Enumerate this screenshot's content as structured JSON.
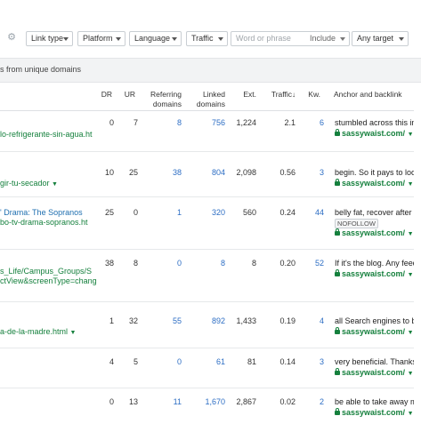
{
  "toolbar": {
    "gear_icon": "gear-icon",
    "link_type": "Link type",
    "platform": "Platform",
    "language": "Language",
    "traffic": "Traffic",
    "phrase_placeholder": "Word or phrase",
    "include": "Include",
    "any_target": "Any target"
  },
  "subheader": "s from unique domains",
  "columns": {
    "dr": "DR",
    "ur": "UR",
    "referring_1": "Referring",
    "referring_2": "domains",
    "linked_1": "Linked",
    "linked_2": "domains",
    "ext": "Ext.",
    "traffic": "Traffic",
    "traffic_sort": "↓",
    "kw": "Kw.",
    "anchor": "Anchor and backlink"
  },
  "rows": [
    {
      "ref_lines": [
        "lo-refrigerante-sin-agua.ht"
      ],
      "dr": "0",
      "ur": "7",
      "rd": "8",
      "ld": "756",
      "ext": "1,224",
      "traffic": "2.1",
      "kw": "6",
      "anchor": "stumbled across this in m",
      "backlink": "sassywaist.com/"
    },
    {
      "ref_lines": [
        "gir-tu-secador"
      ],
      "dr": "10",
      "ur": "25",
      "rd": "38",
      "ld": "804",
      "ext": "2,098",
      "traffic": "0.56",
      "kw": "3",
      "anchor": "begin. So it pays to look f",
      "backlink": "sassywaist.com/"
    },
    {
      "ref_lines": [
        "' Drama: The Sopranos",
        "bo-tv-drama-sopranos.ht"
      ],
      "dr": "25",
      "ur": "0",
      "rd": "1",
      "ld": "320",
      "ext": "560",
      "traffic": "0.24",
      "kw": "44",
      "anchor": "belly fat, recover after giv",
      "badge": "NOFOLLOW",
      "backlink": "sassywaist.com/"
    },
    {
      "ref_lines": [
        "s_Life/Campus_Groups/S",
        "ctView&screenType=chang"
      ],
      "dr": "38",
      "ur": "8",
      "rd": "0",
      "ld": "8",
      "ext": "8",
      "traffic": "0.20",
      "kw": "52",
      "anchor": "If it's the blog. Any feed-b",
      "backlink": "sassywaist.com/"
    },
    {
      "ref_lines": [
        "a-de-la-madre.html"
      ],
      "dr": "1",
      "ur": "32",
      "rd": "55",
      "ld": "892",
      "ext": "1,433",
      "traffic": "0.19",
      "kw": "4",
      "anchor": "all Search engines to be a",
      "backlink": "sassywaist.com/"
    },
    {
      "ref_lines": [],
      "dr": "4",
      "ur": "5",
      "rd": "0",
      "ld": "61",
      "ext": "81",
      "traffic": "0.14",
      "kw": "3",
      "anchor": "very beneficial. Thanks fo",
      "backlink": "sassywaist.com/"
    },
    {
      "ref_lines": [],
      "dr": "0",
      "ur": "13",
      "rd": "11",
      "ld": "1,670",
      "ext": "2,867",
      "traffic": "0.02",
      "kw": "2",
      "anchor": "be able to take away me t",
      "backlink": "sassywaist.com/"
    }
  ]
}
